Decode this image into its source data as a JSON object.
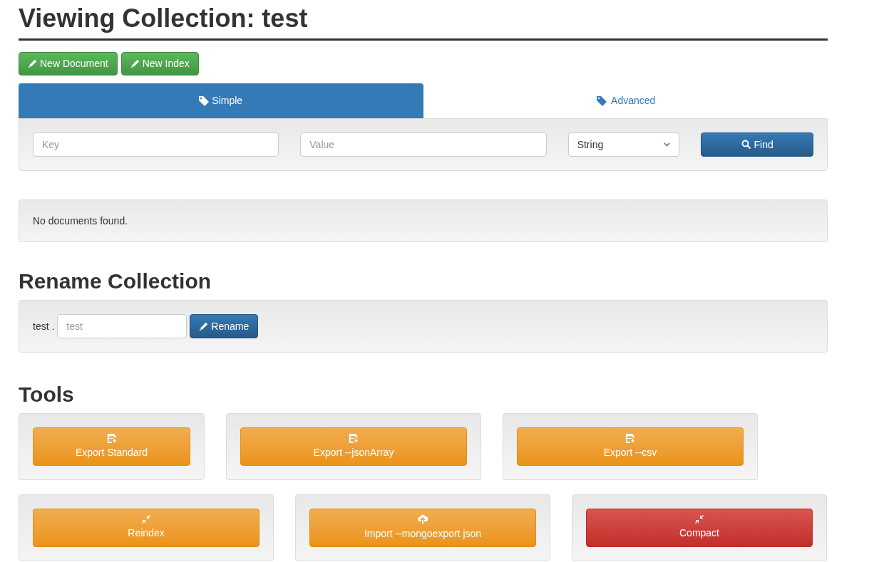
{
  "title": "Viewing Collection: test",
  "actions": [
    {
      "label": "New Document"
    },
    {
      "label": "New Index"
    }
  ],
  "tabs": [
    {
      "label": "Simple",
      "selected": true
    },
    {
      "label": "Advanced",
      "selected": false
    }
  ],
  "search": {
    "key_placeholder": "Key",
    "value_placeholder": "Value",
    "type": "String",
    "button": "Find"
  },
  "results": {
    "message": "No documents found."
  },
  "rename": {
    "heading": "Rename Collection",
    "prefix": "test .",
    "placeholder": "test",
    "button": "Rename"
  },
  "tools": {
    "heading": "Tools",
    "rows": [
      [
        {
          "label": "Export Standard",
          "kind": "warning"
        },
        {
          "label": "Export --jsonArray",
          "kind": "warning"
        },
        {
          "label": "Export --csv",
          "kind": "warning"
        }
      ],
      [
        {
          "label": "Reindex",
          "kind": "warning"
        },
        {
          "label": "Import --mongoexport json",
          "kind": "warning"
        },
        {
          "label": "Compact",
          "kind": "danger"
        }
      ]
    ]
  }
}
